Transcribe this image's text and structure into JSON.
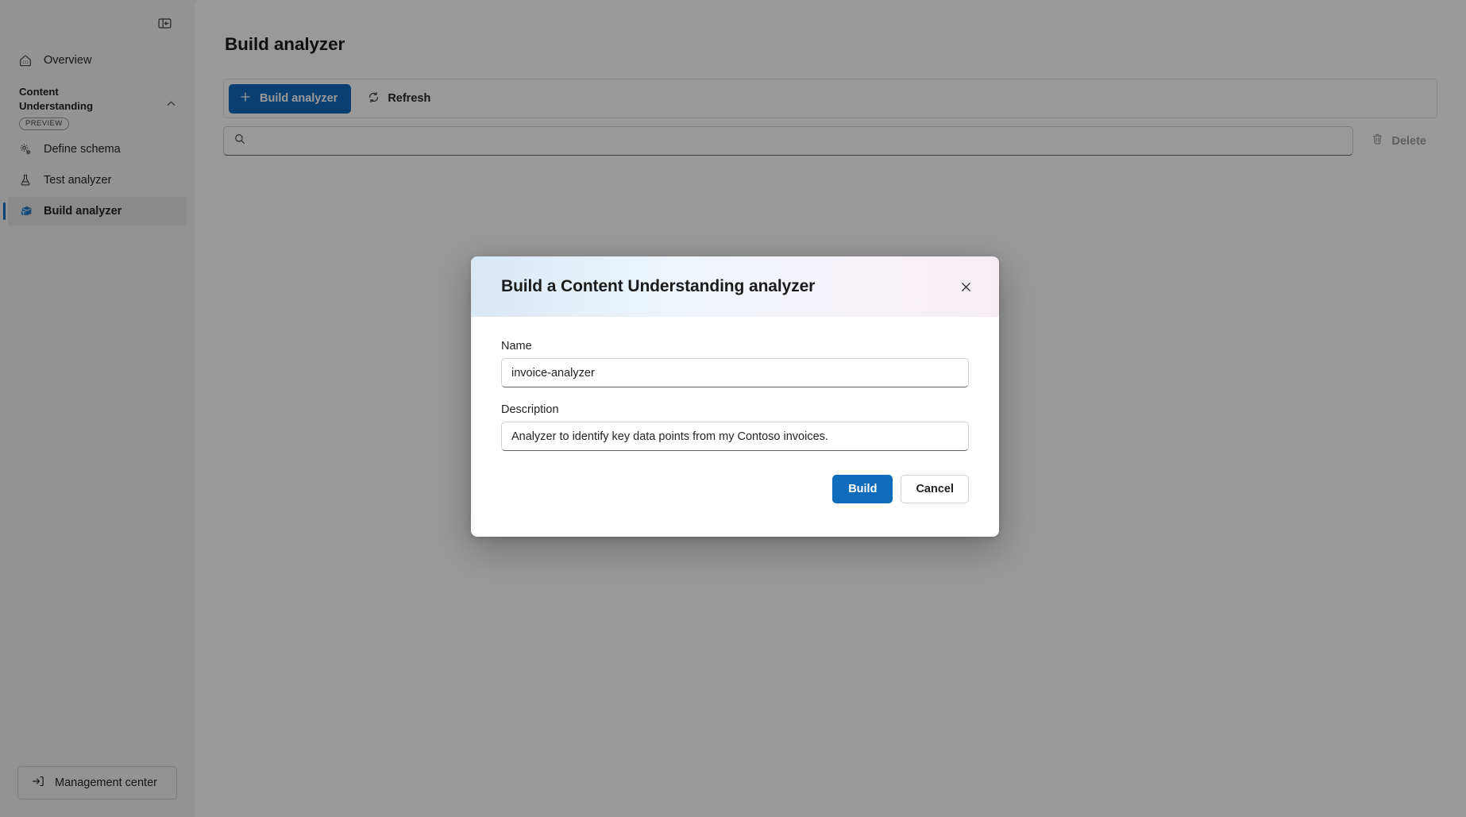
{
  "sidebar": {
    "collapse_icon": "panel-collapse-icon",
    "overview": {
      "label": "Overview",
      "icon": "home-icon"
    },
    "group": {
      "title": "Content Understanding",
      "badge": "PREVIEW",
      "chevron": "chevron-up-icon"
    },
    "items": [
      {
        "label": "Define schema",
        "icon": "gears-icon",
        "selected": false
      },
      {
        "label": "Test analyzer",
        "icon": "beaker-icon",
        "selected": false
      },
      {
        "label": "Build analyzer",
        "icon": "cube-icon",
        "selected": true
      }
    ],
    "footer": {
      "label": "Management center",
      "icon": "sign-in-icon"
    }
  },
  "main": {
    "page_title": "Build analyzer",
    "command_bar": {
      "build_label": "Build analyzer",
      "build_icon": "plus-icon",
      "refresh_label": "Refresh",
      "refresh_icon": "refresh-icon"
    },
    "search": {
      "value": "",
      "placeholder": "",
      "icon": "search-icon"
    },
    "delete": {
      "label": "Delete",
      "icon": "trash-icon",
      "disabled": true
    }
  },
  "dialog": {
    "title": "Build a Content Understanding analyzer",
    "close_icon": "close-icon",
    "name_label": "Name",
    "name_value": "invoice-analyzer",
    "name_placeholder": "",
    "description_label": "Description",
    "description_value": "Analyzer to identify key data points from my Contoso invoices.",
    "description_placeholder": "",
    "build_label": "Build",
    "cancel_label": "Cancel"
  },
  "colors": {
    "accent": "#0f6cbd",
    "page_bg": "#f5f5f5",
    "surface": "#ffffff",
    "selected_nav": "#e6e6e6",
    "header_gradient_start": "#d9e8f5",
    "header_gradient_end": "#f6edf4",
    "disabled_text": "#9e9e9e"
  }
}
